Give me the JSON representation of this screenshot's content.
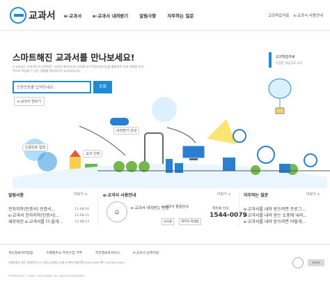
{
  "header": {
    "logo_text": "교과서",
    "nav": [
      "e-교과서",
      "e-교과서 내려받기",
      "알림사항",
      "자주하는 질문"
    ],
    "util": [
      "교과학습자료",
      "e-교과서 사용안내"
    ]
  },
  "hero": {
    "title": "스마트해진 교과서를 만나보세요!",
    "description": "e-교과서는 인터넷으로 다운받아, 다양한 멀티미디어 자료와 교수학습지원기능을 활용하여 교과 내용을 효과적으로 학습할 수 있는 맞춤형 멀티미디어 교과서입니다.",
    "search_placeholder": "인증번호를 입력하세요.",
    "search_button": "조회",
    "ebook_button": "e-교과서 맛보기",
    "callouts": [
      "교과학습자료",
      "다양한 학습자료 보기",
      "내려받기 안내",
      "교과 선택",
      "인증번호 입력"
    ]
  },
  "bottom": {
    "notice": {
      "title": "알림사항",
      "more": "더보기 +",
      "items": [
        {
          "text": "전자저작(인증서) 인증서...",
          "date": "12-08-16"
        },
        {
          "text": "e-교과서 전자저작(인증서)...",
          "date": "12-08-15"
        },
        {
          "text": "새로워진 e-교과서를 더 쉽게...",
          "date": "12-08-13"
        }
      ]
    },
    "guide": {
      "title": "e-교과서 사용안내",
      "more": "더보기 +",
      "guide_text": "e-교과서 내려받는 방법",
      "agent_text": "e-교과서 활용안내",
      "buttons": [
        "교사용",
        "학부모·학생용"
      ],
      "phone_label": "해피콜 안내",
      "phone": "1544-0079"
    },
    "faq": {
      "title": "자주하는 질문",
      "more": "더보기 +",
      "items": [
        "e-교과서를 내려 받으려면 프로그...",
        "e-교과서를 내려 받는 도중에 내려...",
        "e-교과서를 내려 받으려면 어떻게..."
      ]
    }
  },
  "footer": {
    "links": [
      "개인정보처리방침",
      "이메일주소 무단수집 거부",
      "저작권보호서비스",
      "e-교과서 원격지원"
    ],
    "info": "서울특별시 중구 청계천로 00 (다동) 00빌딩 00층 00센터 대표전화 0000-0000 팩스 00-0000-0000",
    "copyright": "COPYRIGHT ⓒ 1999~2012 KERIS. ALL RIGHTS RESERVED.",
    "badges": [
      "KERIS"
    ]
  },
  "colors": {
    "accent": "#1f8ad6",
    "text": "#333333"
  }
}
